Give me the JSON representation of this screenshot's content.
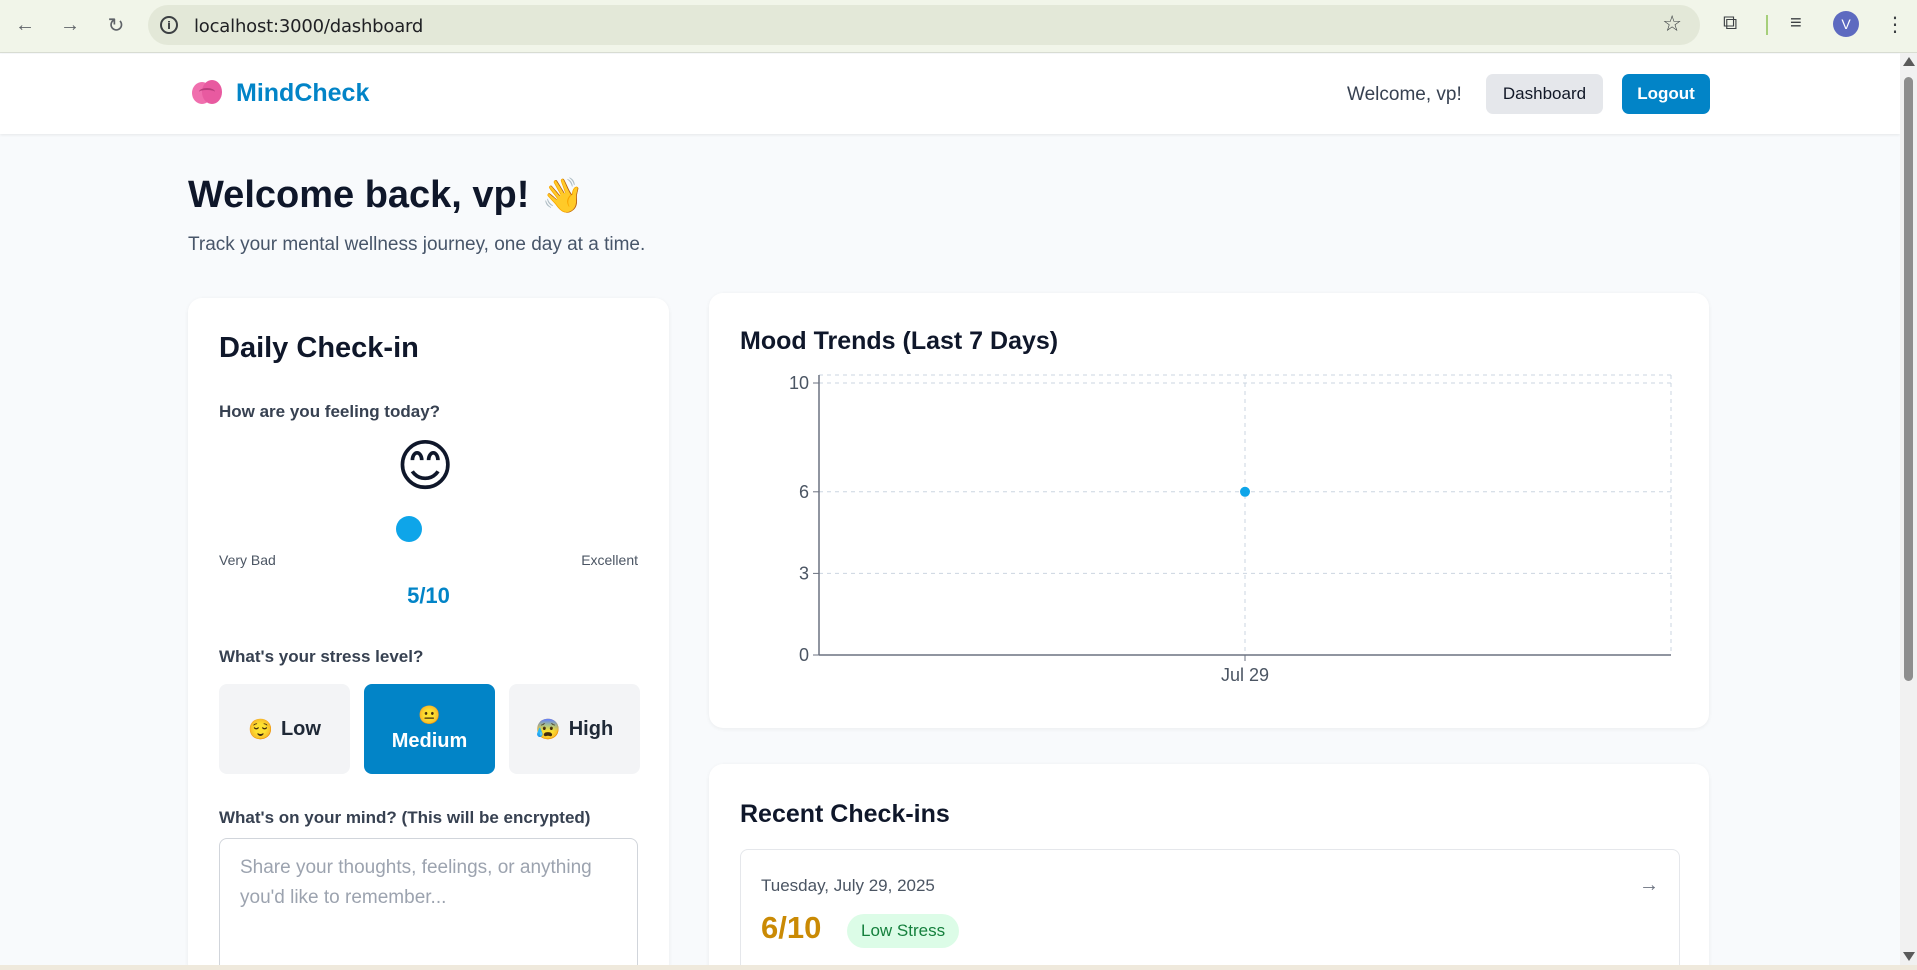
{
  "browser": {
    "url": "localhost:3000/dashboard",
    "profile_initial": "V"
  },
  "header": {
    "brand": "MindCheck",
    "welcome": "Welcome, vp!",
    "dashboard_label": "Dashboard",
    "logout_label": "Logout"
  },
  "page": {
    "title": "Welcome back, vp!",
    "title_emoji": "👋",
    "subtitle": "Track your mental wellness journey, one day at a time."
  },
  "checkin": {
    "title": "Daily Check-in",
    "mood_question": "How are you feeling today?",
    "mood_emoji": "😊",
    "mood_scale_low": "Very Bad",
    "mood_scale_high": "Excellent",
    "mood_value": 5,
    "mood_max": 10,
    "mood_display": "5/10",
    "stress_question": "What's your stress level?",
    "stress_options": [
      {
        "emoji": "😌",
        "label": "Low",
        "selected": false
      },
      {
        "emoji": "😐",
        "label": "Medium",
        "selected": true
      },
      {
        "emoji": "😰",
        "label": "High",
        "selected": false
      }
    ],
    "mind_question": "What's on your mind? (This will be encrypted)",
    "mind_placeholder": "Share your thoughts, feelings, or anything you'd like to remember...",
    "mind_value": ""
  },
  "trends": {
    "title": "Mood Trends (Last 7 Days)"
  },
  "chart_data": {
    "type": "scatter",
    "title": "Mood Trends (Last 7 Days)",
    "x": [
      "Jul 29"
    ],
    "values": [
      6
    ],
    "yticks": [
      0,
      3,
      6,
      10
    ],
    "ylim": [
      0,
      10
    ],
    "grid": true,
    "xlabel": "",
    "ylabel": "",
    "point_color": "#0ea5e9"
  },
  "recent": {
    "title": "Recent Check-ins",
    "items": [
      {
        "date": "Tuesday, July 29, 2025",
        "score": "6/10",
        "stress": "Low Stress",
        "arrow": "→"
      }
    ]
  },
  "colors": {
    "primary": "#0284c7",
    "accent": "#0ea5e9",
    "score": "#ca8a04",
    "badge_bg": "#dcfce7",
    "badge_text": "#15803d"
  }
}
